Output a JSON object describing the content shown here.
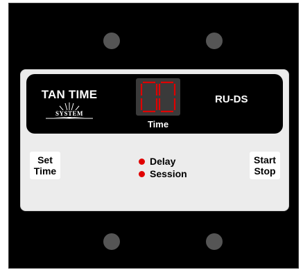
{
  "brand": {
    "title": "TAN TIME",
    "subtitle": "SYSTEM"
  },
  "display": {
    "digits": "00",
    "label": "Time",
    "digit_color": "#e00000"
  },
  "model": "RU-DS",
  "buttons": {
    "set": {
      "line1": "Set",
      "line2": "Time"
    },
    "start": {
      "line1": "Start",
      "line2": "Stop"
    }
  },
  "indicators": [
    {
      "label": "Delay",
      "color": "#e00000"
    },
    {
      "label": "Session",
      "color": "#e00000"
    }
  ]
}
